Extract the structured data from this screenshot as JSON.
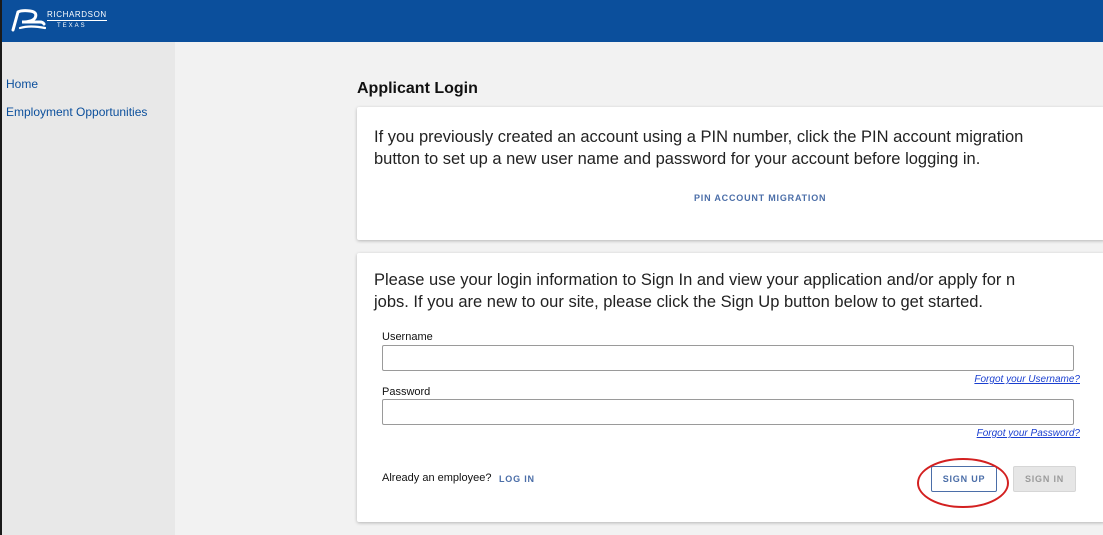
{
  "header": {
    "brand": {
      "name": "RICHARDSON",
      "region": "TEXAS"
    },
    "bar_color": "#0b4f9c"
  },
  "sidebar": {
    "items": [
      {
        "label": "Home"
      },
      {
        "label": "Employment Opportunities"
      }
    ]
  },
  "main": {
    "page_title": "Applicant Login",
    "migration_card": {
      "text_line1": "If you previously created an account using a PIN number, click the PIN account migration",
      "text_line2": "button to set up a new user name and password for your account before logging in.",
      "button_label": "PIN ACCOUNT MIGRATION"
    },
    "login_card": {
      "text_line1": "Please use your login information to Sign In and view your application and/or apply for n",
      "text_line2": "jobs. If you are new to our site, please click the Sign Up button below to get started.",
      "username": {
        "label": "Username",
        "value": "",
        "forgot_label": "Forgot your Username?"
      },
      "password": {
        "label": "Password",
        "value": "",
        "forgot_label": "Forgot your Password?"
      },
      "employee_prompt": "Already an employee?",
      "login_label": "LOG IN",
      "signup_label": "SIGN UP",
      "signin_label": "SIGN IN"
    }
  },
  "colors": {
    "accent": "#4b6ea8",
    "link": "#1a3fd0",
    "annotation": "#d32020"
  }
}
